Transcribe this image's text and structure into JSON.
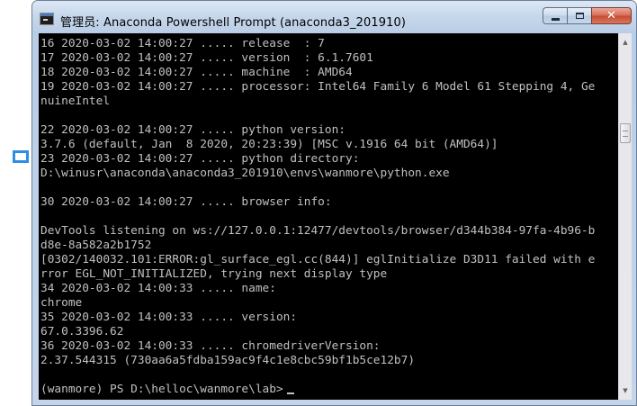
{
  "window": {
    "title": "管理员: Anaconda Powershell Prompt (anaconda3_201910)",
    "controls": {
      "close_label": "✕"
    }
  },
  "console": {
    "lines": [
      "16 2020-03-02 14:00:27 ..... release  : 7",
      "17 2020-03-02 14:00:27 ..... version  : 6.1.7601",
      "18 2020-03-02 14:00:27 ..... machine  : AMD64",
      "19 2020-03-02 14:00:27 ..... processor: Intel64 Family 6 Model 61 Stepping 4, Ge",
      "nuineIntel",
      "",
      "22 2020-03-02 14:00:27 ..... python version:",
      "3.7.6 (default, Jan  8 2020, 20:23:39) [MSC v.1916 64 bit (AMD64)]",
      "23 2020-03-02 14:00:27 ..... python directory:",
      "D:\\winusr\\anaconda\\anaconda3_201910\\envs\\wanmore\\python.exe",
      "",
      "30 2020-03-02 14:00:27 ..... browser info:",
      "",
      "DevTools listening on ws://127.0.0.1:12477/devtools/browser/d344b384-97fa-4b96-b",
      "d8e-8a582a2b1752",
      "[0302/140032.101:ERROR:gl_surface_egl.cc(844)] eglInitialize D3D11 failed with e",
      "rror EGL_NOT_INITIALIZED, trying next display type",
      "34 2020-03-02 14:00:33 ..... name:",
      "chrome",
      "35 2020-03-02 14:00:33 ..... version:",
      "67.0.3396.62",
      "36 2020-03-02 14:00:33 ..... chromedriverVersion:",
      "2.37.544315 (730aa6a5fdba159ac9f4c1e8cbc59bf1b5ce12b7)",
      "",
      "(wanmore) PS D:\\helloc\\wanmore\\lab>"
    ]
  },
  "colors": {
    "console_background": "#000000",
    "console_text": "#c0c0c0",
    "selection_marker": "#2e8de6"
  },
  "icons": {
    "app": "console-app-icon",
    "minimize": "minimize-icon",
    "maximize": "maximize-icon",
    "close": "close-icon",
    "scroll_up": "scroll-up-arrow-icon",
    "scroll_down": "scroll-down-arrow-icon"
  }
}
